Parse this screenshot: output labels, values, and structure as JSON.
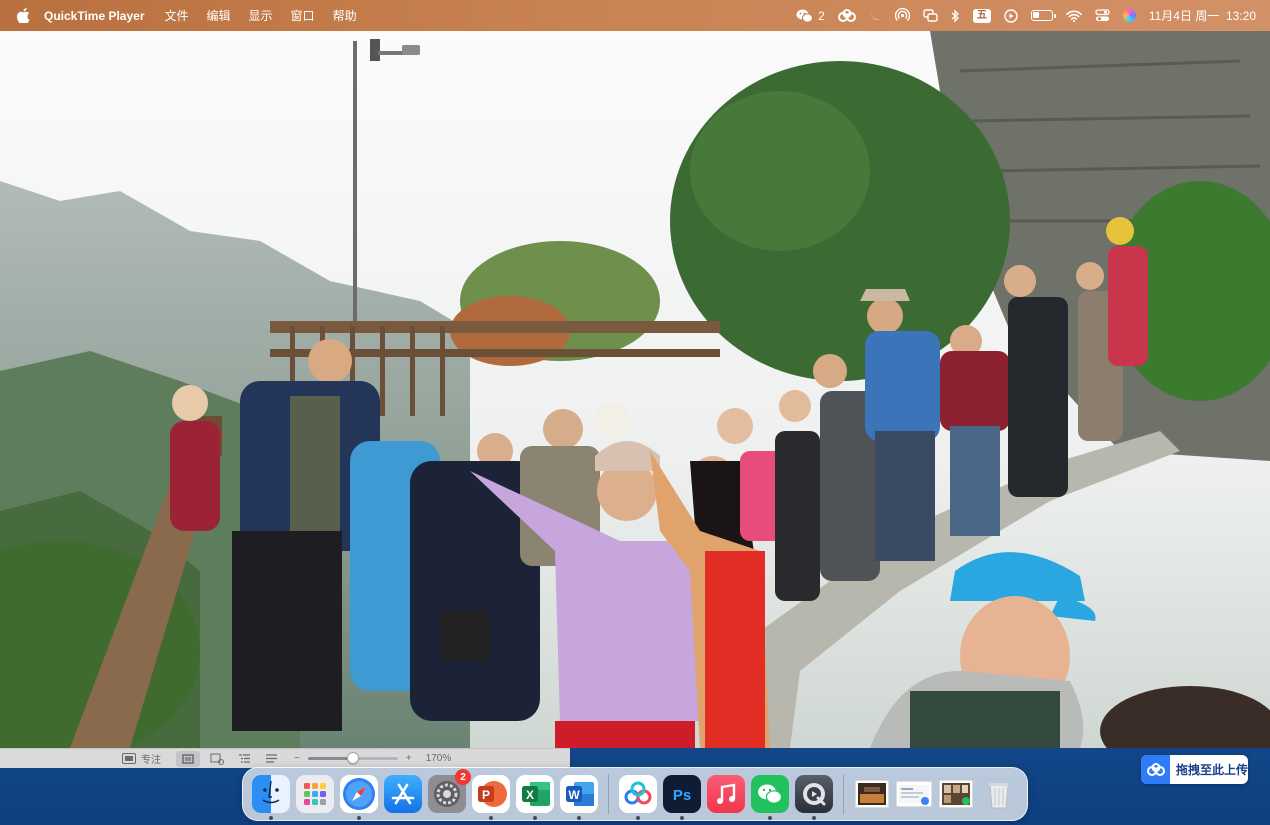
{
  "menubar": {
    "app_name": "QuickTime Player",
    "menus": [
      "文件",
      "编辑",
      "显示",
      "窗口",
      "帮助"
    ],
    "wechat_count": "2",
    "input_method": "五",
    "battery_level": 0.35,
    "datetime": "11月4日 周一  13:20"
  },
  "controls": {
    "focus_label": "专注",
    "zoom_level": "170%",
    "zoom_fraction": 0.5
  },
  "dock": {
    "apps": [
      {
        "name": "finder-icon",
        "color": "#2b8ef5",
        "running": true
      },
      {
        "name": "launchpad-icon",
        "color": "#e8e8ec",
        "running": false
      },
      {
        "name": "safari-icon",
        "color": "#2f80f2",
        "running": true
      },
      {
        "name": "app-store-icon",
        "color": "#1c8cf3",
        "running": false
      },
      {
        "name": "system-settings-icon",
        "color": "#6d6d72",
        "running": false,
        "badge": "2"
      },
      {
        "name": "powerpoint-icon",
        "color": "#d24726",
        "running": true
      },
      {
        "name": "excel-icon",
        "color": "#1d7a45",
        "running": true
      },
      {
        "name": "word-icon",
        "color": "#2b5cb8",
        "running": true
      },
      {
        "name": "baidu-netdisk-icon",
        "color": "#ffffff",
        "running": true
      },
      {
        "name": "photoshop-icon",
        "color": "#0f1c33",
        "running": true
      },
      {
        "name": "music-icon",
        "color": "#f0374f",
        "running": false
      },
      {
        "name": "wechat-icon",
        "color": "#21c25e",
        "running": true
      },
      {
        "name": "quicktime-icon",
        "color": "#3a3f4a",
        "running": true
      }
    ],
    "recent": [
      {
        "name": "recent-photo-1-icon"
      },
      {
        "name": "recent-document-icon"
      },
      {
        "name": "recent-photo-2-icon"
      }
    ]
  },
  "upload": {
    "label": "拖拽至此上传",
    "color": "#2f7df6"
  }
}
